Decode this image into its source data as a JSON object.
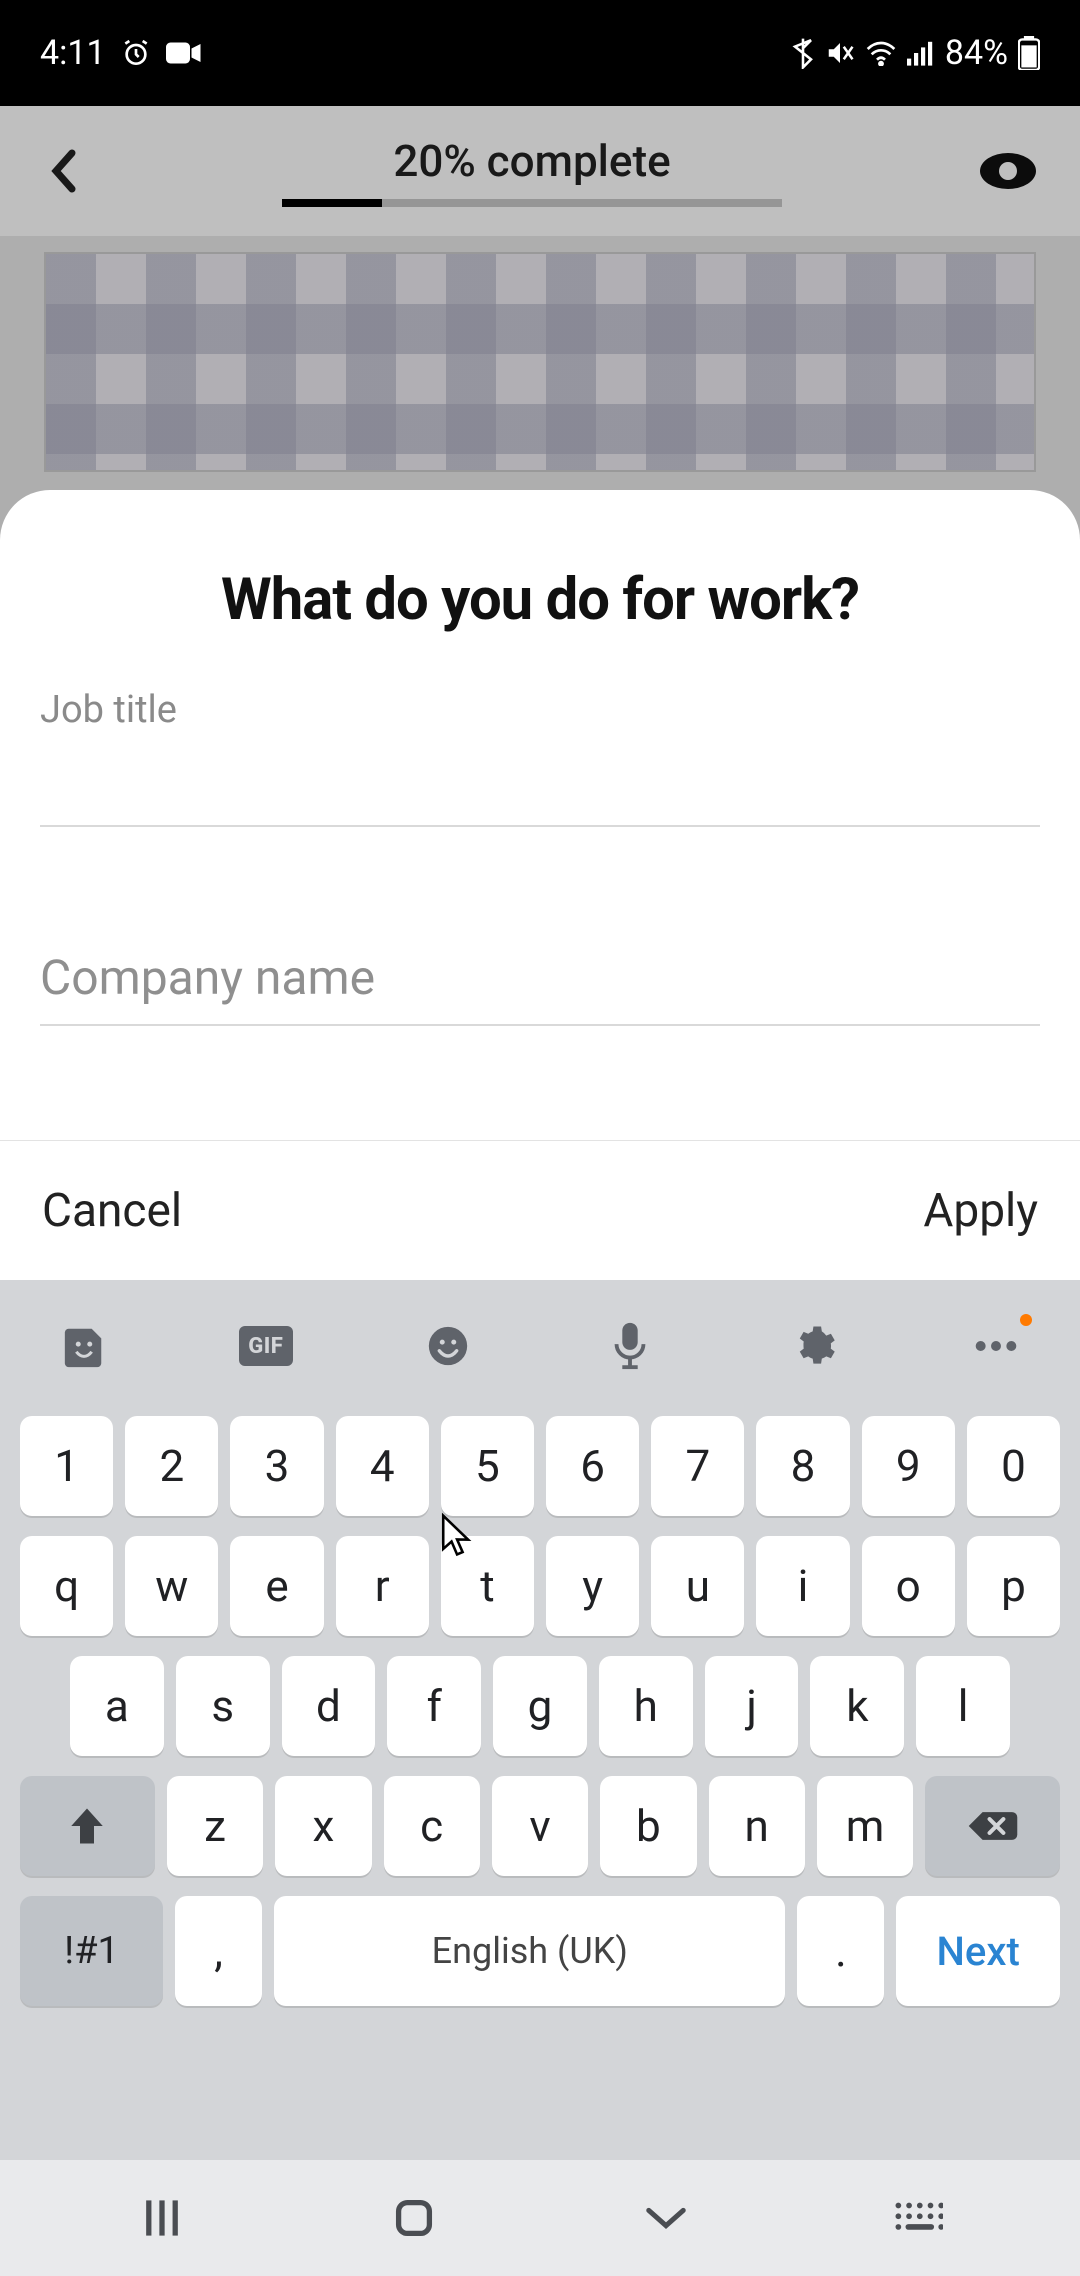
{
  "status": {
    "time": "4:11",
    "battery_pct": "84%"
  },
  "header": {
    "progress_label": "20% complete",
    "progress_pct": 20
  },
  "sheet": {
    "title": "What do you do for work?",
    "job_title_label": "Job title",
    "job_title_value": "",
    "company_placeholder": "Company name",
    "company_value": "",
    "cancel_label": "Cancel",
    "apply_label": "Apply"
  },
  "keyboard": {
    "toolbar": [
      "sticker",
      "gif",
      "emoji",
      "mic",
      "settings",
      "more"
    ],
    "row_num": [
      "1",
      "2",
      "3",
      "4",
      "5",
      "6",
      "7",
      "8",
      "9",
      "0"
    ],
    "row_q": [
      "q",
      "w",
      "e",
      "r",
      "t",
      "y",
      "u",
      "i",
      "o",
      "p"
    ],
    "row_a": [
      "a",
      "s",
      "d",
      "f",
      "g",
      "h",
      "j",
      "k",
      "l"
    ],
    "row_z": [
      "z",
      "x",
      "c",
      "v",
      "b",
      "n",
      "m"
    ],
    "sym_label": "!#1",
    "comma": ",",
    "space_label": "English (UK)",
    "period": ".",
    "action_label": "Next"
  },
  "nav": {
    "items": [
      "recents",
      "home",
      "back",
      "ime"
    ]
  }
}
